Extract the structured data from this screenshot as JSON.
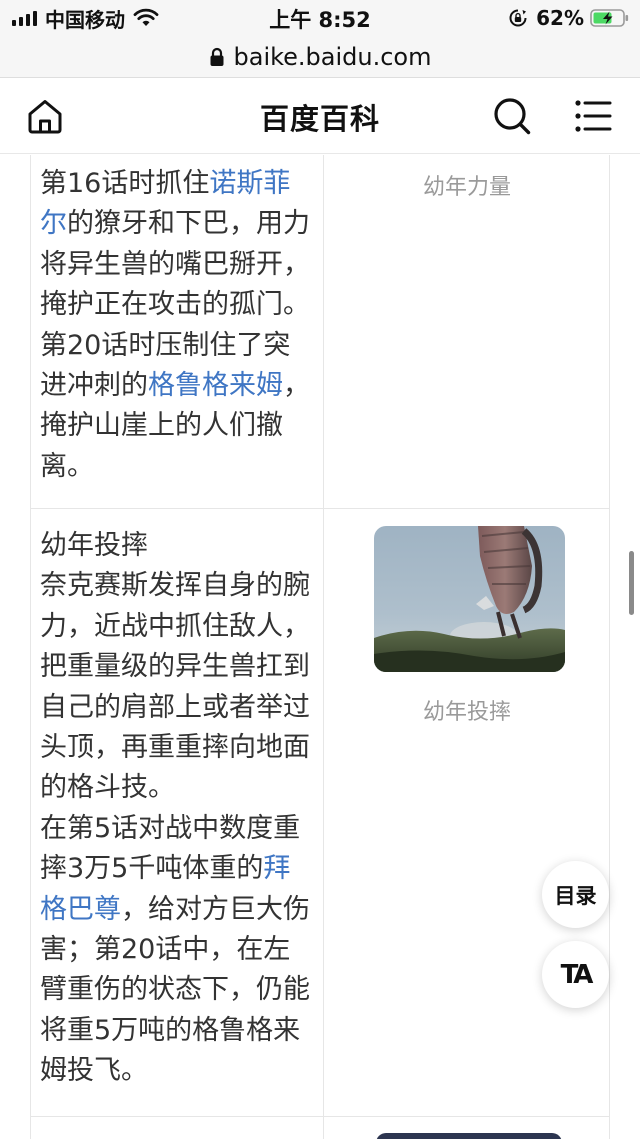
{
  "status_bar": {
    "carrier": "中国移动",
    "time": "上午 8:52",
    "battery_percent": "62%",
    "battery_level": 0.62,
    "icons": [
      "signal-icon",
      "wifi-icon",
      "rotation-lock-icon",
      "battery-charging-icon"
    ]
  },
  "url_bar": {
    "url": "baike.baidu.com",
    "icon": "lock-icon"
  },
  "header": {
    "title": "百度百科",
    "icons": [
      "home-icon",
      "search-icon",
      "menu-icon"
    ]
  },
  "table": {
    "row1": {
      "lines": [
        [
          {
            "text": "第16话时抓住"
          },
          {
            "text": "诺斯菲",
            "link": true
          }
        ],
        [
          {
            "text": "尔",
            "link": true
          },
          {
            "text": "的獠牙和下巴，用力"
          }
        ],
        [
          {
            "text": "将异生兽的嘴巴掰开，"
          }
        ],
        [
          {
            "text": "掩护正在攻击的孤门。"
          }
        ],
        [
          {
            "text": "第20话时压制住了突"
          }
        ],
        [
          {
            "text": "进冲刺的"
          },
          {
            "text": "格鲁格来姆",
            "link": true
          },
          {
            "text": "，"
          }
        ],
        [
          {
            "text": "掩护山崖上的人们撤"
          }
        ],
        [
          {
            "text": "离。"
          }
        ]
      ],
      "caption": "幼年力量"
    },
    "row2": {
      "lines": [
        [
          {
            "text": "幼年投摔"
          }
        ],
        [
          {
            "text": "奈克赛斯发挥自身的腕"
          }
        ],
        [
          {
            "text": "力，近战中抓住敌人，"
          }
        ],
        [
          {
            "text": "把重量级的异生兽扛到"
          }
        ],
        [
          {
            "text": "自己的肩部上或者举过"
          }
        ],
        [
          {
            "text": "头顶，再重重摔向地面"
          }
        ],
        [
          {
            "text": "的格斗技。"
          }
        ],
        [
          {
            "text": "在第5话对战中数度重"
          }
        ],
        [
          {
            "text": "摔3万5千吨体重的"
          },
          {
            "text": "拜",
            "link": true
          }
        ],
        [
          {
            "text": "格巴尊",
            "link": true
          },
          {
            "text": "，给对方巨大伤"
          }
        ],
        [
          {
            "text": "害；第20话中，在左"
          }
        ],
        [
          {
            "text": "臂重伤的状态下，仍能"
          }
        ],
        [
          {
            "text": "将重5万吨的格鲁格来"
          }
        ],
        [
          {
            "text": "姆投飞。"
          }
        ]
      ],
      "caption": "幼年投摔",
      "image": "still of a giant monster lifted above a grassy hillside"
    }
  },
  "floating": {
    "toc_label": "目录",
    "ta_label": "TA"
  },
  "colors": {
    "link": "#3f76c4",
    "caption": "#9a9a9a",
    "text": "#333333",
    "divider": "#e6e6e6"
  }
}
